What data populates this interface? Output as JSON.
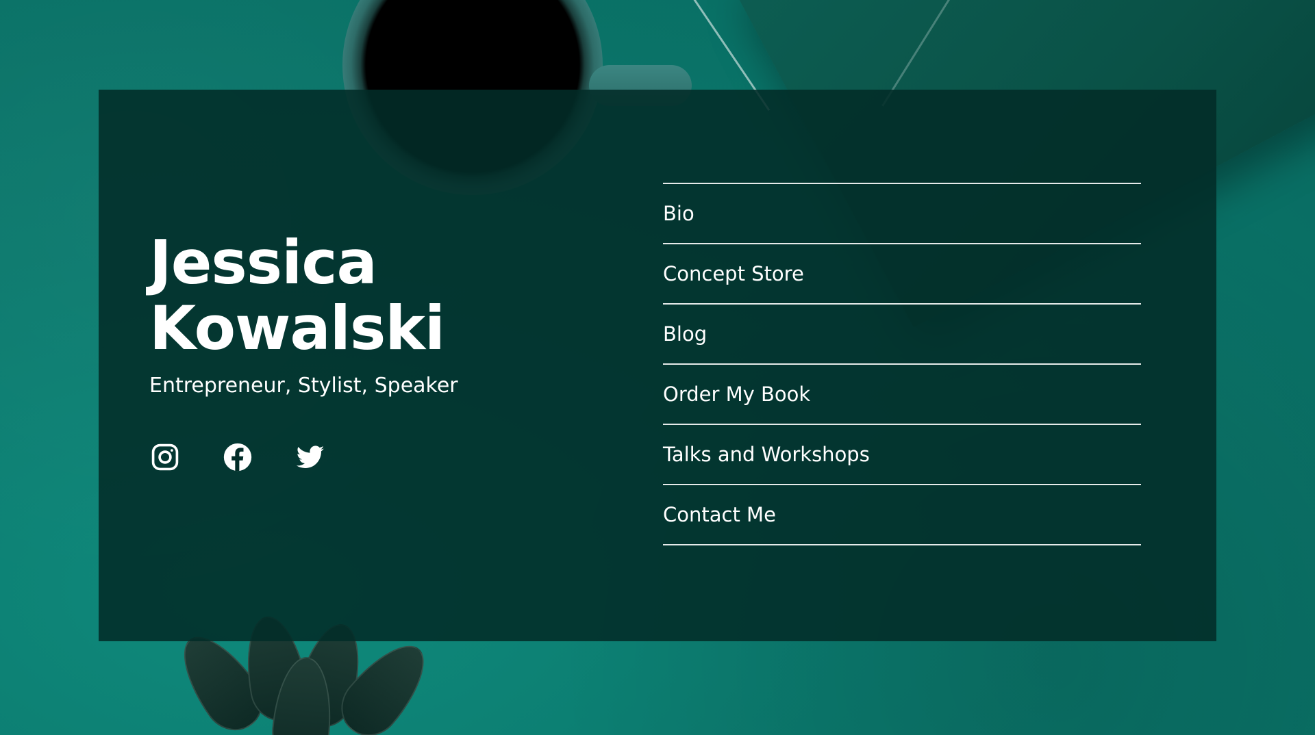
{
  "profile": {
    "first_name": "Jessica",
    "last_name": "Kowalski",
    "tagline": "Entrepreneur, Stylist, Speaker"
  },
  "social_icons": [
    "instagram-icon",
    "facebook-icon",
    "twitter-icon"
  ],
  "nav": {
    "items": [
      {
        "label": "Bio"
      },
      {
        "label": "Concept Store"
      },
      {
        "label": "Blog"
      },
      {
        "label": "Order My Book"
      },
      {
        "label": "Talks and Workshops"
      },
      {
        "label": "Contact Me"
      }
    ]
  },
  "colors": {
    "background": "#0b7a6e",
    "card": "#022c28",
    "text": "#ffffff"
  }
}
